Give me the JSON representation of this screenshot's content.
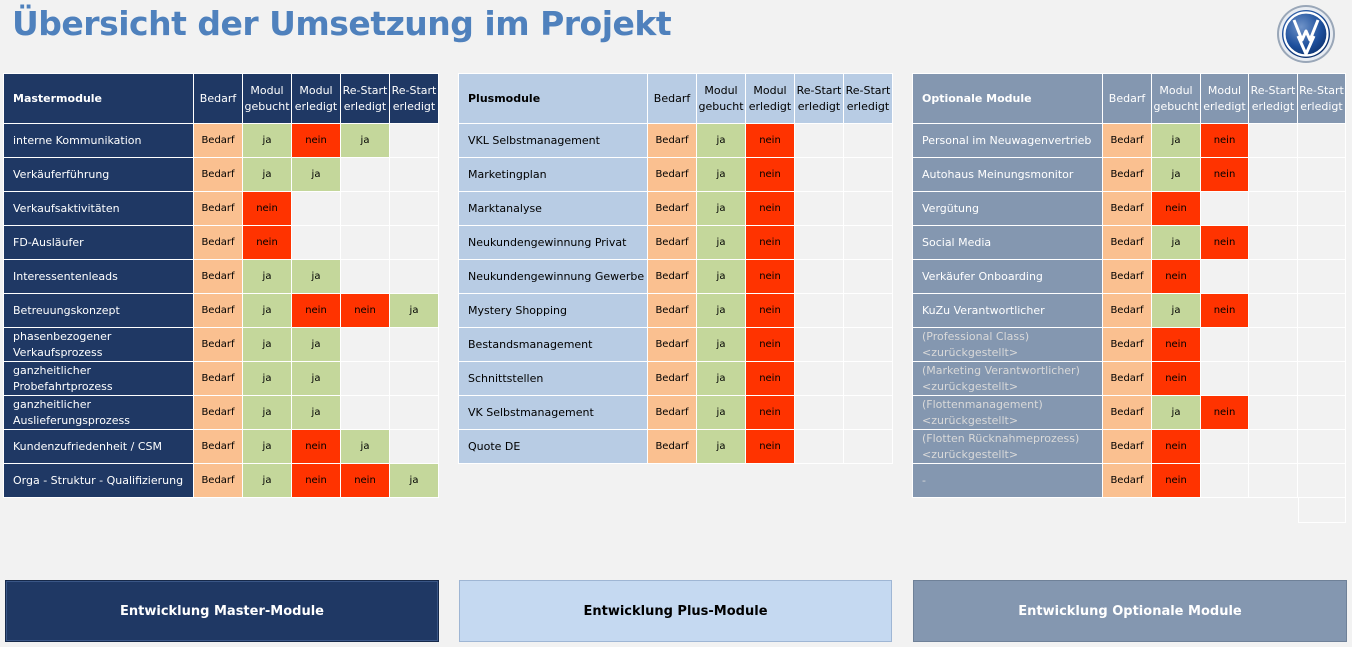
{
  "page": {
    "title": "Übersicht der Umsetzung im Projekt"
  },
  "logo": {
    "icon": "vw-logo-icon"
  },
  "colors": {
    "bedarf": "#fac090",
    "ja": "#c4d79b",
    "nein": "#ff3300",
    "master": "#1f3864",
    "plus": "#b8cce4",
    "optional": "#8497b0"
  },
  "columns": [
    "Bedarf",
    "Modul gebucht",
    "Modul erledigt",
    "Re-Start erledigt",
    "Re-Start erledigt"
  ],
  "master": {
    "header": "Mastermodule",
    "rows": [
      {
        "name": "interne Kommunikation",
        "cells": [
          "Bedarf",
          "ja",
          "nein",
          "ja",
          ""
        ]
      },
      {
        "name": "Verkäuferführung",
        "cells": [
          "Bedarf",
          "ja",
          "ja",
          "",
          ""
        ]
      },
      {
        "name": "Verkaufsaktivitäten",
        "cells": [
          "Bedarf",
          "nein",
          "",
          "",
          ""
        ]
      },
      {
        "name": "FD-Ausläufer",
        "cells": [
          "Bedarf",
          "nein",
          "",
          "",
          ""
        ]
      },
      {
        "name": "Interessentenleads",
        "cells": [
          "Bedarf",
          "ja",
          "ja",
          "",
          ""
        ]
      },
      {
        "name": "Betreuungskonzept",
        "cells": [
          "Bedarf",
          "ja",
          "nein",
          "nein",
          "ja"
        ]
      },
      {
        "name": "phasenbezogener Verkaufsprozess",
        "cells": [
          "Bedarf",
          "ja",
          "ja",
          "",
          ""
        ]
      },
      {
        "name": "ganzheitlicher Probefahrtprozess",
        "cells": [
          "Bedarf",
          "ja",
          "ja",
          "",
          ""
        ]
      },
      {
        "name": "ganzheitlicher Auslieferungsprozess",
        "cells": [
          "Bedarf",
          "ja",
          "ja",
          "",
          ""
        ]
      },
      {
        "name": "Kundenzufriedenheit / CSM",
        "cells": [
          "Bedarf",
          "ja",
          "nein",
          "ja",
          ""
        ]
      },
      {
        "name": "Orga - Struktur - Qualifizierung",
        "cells": [
          "Bedarf",
          "ja",
          "nein",
          "nein",
          "ja"
        ]
      }
    ]
  },
  "plus": {
    "header": "Plusmodule",
    "rows": [
      {
        "name": "VKL Selbstmanagement",
        "cells": [
          "Bedarf",
          "ja",
          "nein",
          "",
          ""
        ]
      },
      {
        "name": "Marketingplan",
        "cells": [
          "Bedarf",
          "ja",
          "nein",
          "",
          ""
        ]
      },
      {
        "name": "Marktanalyse",
        "cells": [
          "Bedarf",
          "ja",
          "nein",
          "",
          ""
        ]
      },
      {
        "name": "Neukundengewinnung Privat",
        "cells": [
          "Bedarf",
          "ja",
          "nein",
          "",
          ""
        ]
      },
      {
        "name": "Neukundengewinnung Gewerbe",
        "cells": [
          "Bedarf",
          "ja",
          "nein",
          "",
          ""
        ]
      },
      {
        "name": "Mystery Shopping",
        "cells": [
          "Bedarf",
          "ja",
          "nein",
          "",
          ""
        ]
      },
      {
        "name": "Bestandsmanagement",
        "cells": [
          "Bedarf",
          "ja",
          "nein",
          "",
          ""
        ]
      },
      {
        "name": "Schnittstellen",
        "cells": [
          "Bedarf",
          "ja",
          "nein",
          "",
          ""
        ]
      },
      {
        "name": "VK Selbstmanagement",
        "cells": [
          "Bedarf",
          "ja",
          "nein",
          "",
          ""
        ]
      },
      {
        "name": "Quote DE",
        "cells": [
          "Bedarf",
          "ja",
          "nein",
          "",
          ""
        ]
      }
    ]
  },
  "optional": {
    "header": "Optionale Module",
    "rows": [
      {
        "name": "Personal im Neuwagenvertrieb",
        "cells": [
          "Bedarf",
          "ja",
          "nein",
          "",
          ""
        ]
      },
      {
        "name": "Autohaus Meinungsmonitor",
        "cells": [
          "Bedarf",
          "ja",
          "nein",
          "",
          ""
        ]
      },
      {
        "name": "Vergütung",
        "cells": [
          "Bedarf",
          "nein",
          "",
          "",
          ""
        ]
      },
      {
        "name": "Social Media",
        "cells": [
          "Bedarf",
          "ja",
          "nein",
          "",
          ""
        ]
      },
      {
        "name": "Verkäufer Onboarding",
        "cells": [
          "Bedarf",
          "nein",
          "",
          "",
          ""
        ]
      },
      {
        "name": "KuZu Verantwortlicher",
        "cells": [
          "Bedarf",
          "ja",
          "nein",
          "",
          ""
        ]
      },
      {
        "name": "(Professional Class) <zurückgestellt>",
        "dim": true,
        "cells": [
          "Bedarf",
          "nein",
          "",
          "",
          ""
        ]
      },
      {
        "name": "(Marketing Verantwortlicher) <zurückgestellt>",
        "dim": true,
        "cells": [
          "Bedarf",
          "nein",
          "",
          "",
          ""
        ]
      },
      {
        "name": "(Flottenmanagement) <zurückgestellt>",
        "dim": true,
        "cells": [
          "Bedarf",
          "ja",
          "nein",
          "",
          ""
        ]
      },
      {
        "name": "(Flotten Rücknahmeprozess) <zurückgestellt>",
        "dim": true,
        "cells": [
          "Bedarf",
          "nein",
          "",
          "",
          ""
        ]
      },
      {
        "name": "-",
        "dim": true,
        "cells": [
          "Bedarf",
          "nein",
          "",
          "",
          ""
        ]
      }
    ]
  },
  "buttons": {
    "master": "Entwicklung Master-Module",
    "plus": "Entwicklung Plus-Module",
    "optional": "Entwicklung Optionale Module"
  }
}
